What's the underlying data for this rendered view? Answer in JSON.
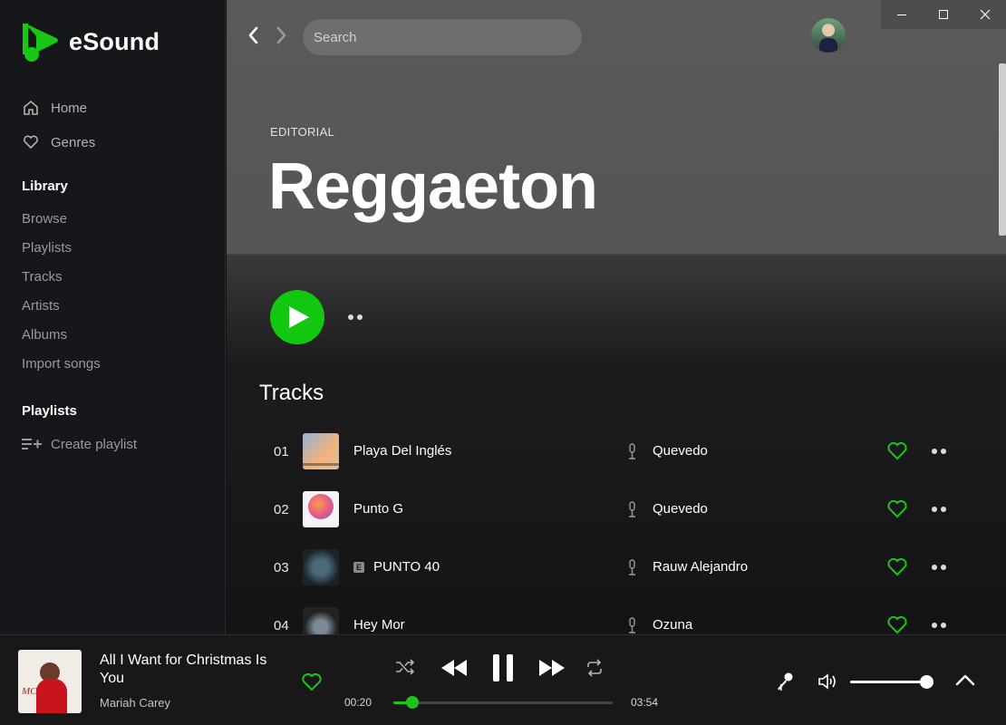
{
  "app": {
    "name": "eSound",
    "brand_color": "#11c70f"
  },
  "sidebar": {
    "nav": [
      {
        "label": "Home",
        "icon": "home-icon"
      },
      {
        "label": "Genres",
        "icon": "heart-outline-icon"
      }
    ],
    "library_title": "Library",
    "library_items": [
      "Browse",
      "Playlists",
      "Tracks",
      "Artists",
      "Albums",
      "Import songs"
    ],
    "playlists_title": "Playlists",
    "create_playlist": "Create playlist"
  },
  "header": {
    "search_placeholder": "Search"
  },
  "page": {
    "eyebrow": "EDITORIAL",
    "title": "Reggaeton",
    "section": "Tracks"
  },
  "tracks": [
    {
      "num": "01",
      "title": "Playa Del Inglés",
      "artist": "Quevedo",
      "explicit": false
    },
    {
      "num": "02",
      "title": "Punto G",
      "artist": "Quevedo",
      "explicit": false
    },
    {
      "num": "03",
      "title": "PUNTO 40",
      "artist": "Rauw Alejandro",
      "explicit": true,
      "explicit_label": "E"
    },
    {
      "num": "04",
      "title": "Hey Mor",
      "artist": "Ozuna",
      "explicit": false
    }
  ],
  "player": {
    "title": "All I Want for Christmas Is You",
    "artist": "Mariah Carey",
    "elapsed": "00:20",
    "duration": "03:54",
    "progress": 0.085,
    "volume": 1.0,
    "state": "playing"
  }
}
